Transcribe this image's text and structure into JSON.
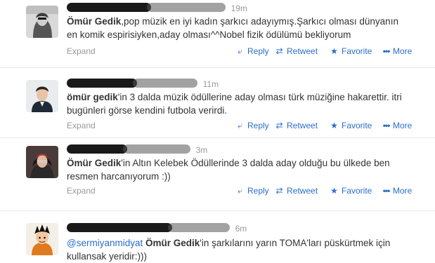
{
  "tweets": [
    {
      "time": "19m",
      "lines": [
        [
          {
            "t": "Ömür Gedik",
            "b": true
          },
          {
            "t": ",pop müzik en iyi kadın şarkıcı adayıymış.Şarkıcı olması dünyanın"
          }
        ],
        [
          {
            "t": "en komik espirisiyken,aday olması^^Nobel fizik ödülümü bekliyorum"
          }
        ]
      ],
      "expand": "Expand",
      "reply": "Reply",
      "retweet": "Retweet",
      "favorite": "Favorite",
      "more": "More"
    },
    {
      "time": "11m",
      "lines": [
        [
          {
            "t": "ömür gedik",
            "b": true
          },
          {
            "t": "'in 3 dalda müzik ödüllerine aday olması türk müziğine hakarettir. itri"
          }
        ],
        [
          {
            "t": "bugünleri görse kendini futbola verirdi."
          }
        ]
      ],
      "expand": "Expand",
      "reply": "Reply",
      "retweet": "Retweet",
      "favorite": "Favorite",
      "more": "More"
    },
    {
      "time": "3m",
      "lines": [
        [
          {
            "t": "Ömür Gedik",
            "b": true
          },
          {
            "t": "'in Altın Kelebek Ödüllerinde 3 dalda aday olduğu bu ülkede ben"
          }
        ],
        [
          {
            "t": "resmen harcanıyorum :))"
          }
        ]
      ],
      "expand": "Expand",
      "reply": "Reply",
      "retweet": "Retweet",
      "favorite": "Favorite",
      "more": "More"
    },
    {
      "time": "6m",
      "lines": [
        [
          {
            "t": "@sermiyanmidyat",
            "m": true
          },
          {
            "t": " "
          },
          {
            "t": "Ömür Gedik",
            "b": true
          },
          {
            "t": "'in şarkılarını yarın TOMA'ları püskürtmek için"
          }
        ],
        [
          {
            "t": "kullansak yeridir:)))"
          }
        ]
      ]
    }
  ],
  "icons": {
    "reply": "reply-arrow-icon",
    "retweet": "retweet-arrows-icon",
    "favorite": "star-icon",
    "more": "more-dots-icon"
  },
  "colors": {
    "link": "#2a6fc9",
    "muted": "#999999",
    "text": "#333333"
  }
}
